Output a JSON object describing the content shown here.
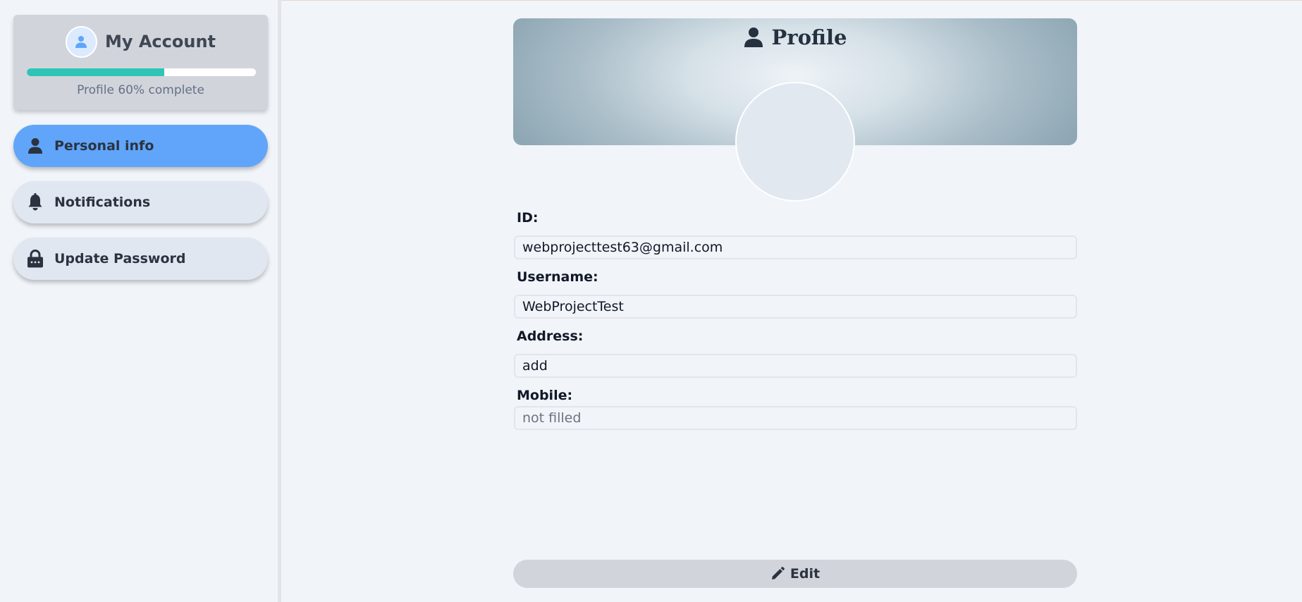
{
  "sidebar": {
    "account": {
      "title": "My Account",
      "avatar_icon": "user-icon",
      "progress_percent": 60,
      "progress_text": "Profile 60% complete"
    },
    "items": [
      {
        "label": "Personal info",
        "icon": "user-icon",
        "active": true
      },
      {
        "label": "Notifications",
        "icon": "bell-icon",
        "active": false
      },
      {
        "label": "Update Password",
        "icon": "lock-icon",
        "active": false
      }
    ]
  },
  "main": {
    "title": "Profile",
    "title_icon": "user-icon",
    "fields": [
      {
        "label": "ID:",
        "value": "webprojecttest63@gmail.com",
        "placeholder": false
      },
      {
        "label": "Username:",
        "value": "WebProjectTest",
        "placeholder": false
      },
      {
        "label": "Address:",
        "value": "add",
        "placeholder": false
      },
      {
        "label": "Mobile:",
        "value": "not filled",
        "placeholder": true
      }
    ],
    "edit_label": "Edit",
    "edit_icon": "pencil-icon"
  },
  "colors": {
    "accent": "#60a5fa",
    "progress": "#2ec4b6",
    "card": "#d1d5db",
    "background": "#f1f4f9"
  }
}
